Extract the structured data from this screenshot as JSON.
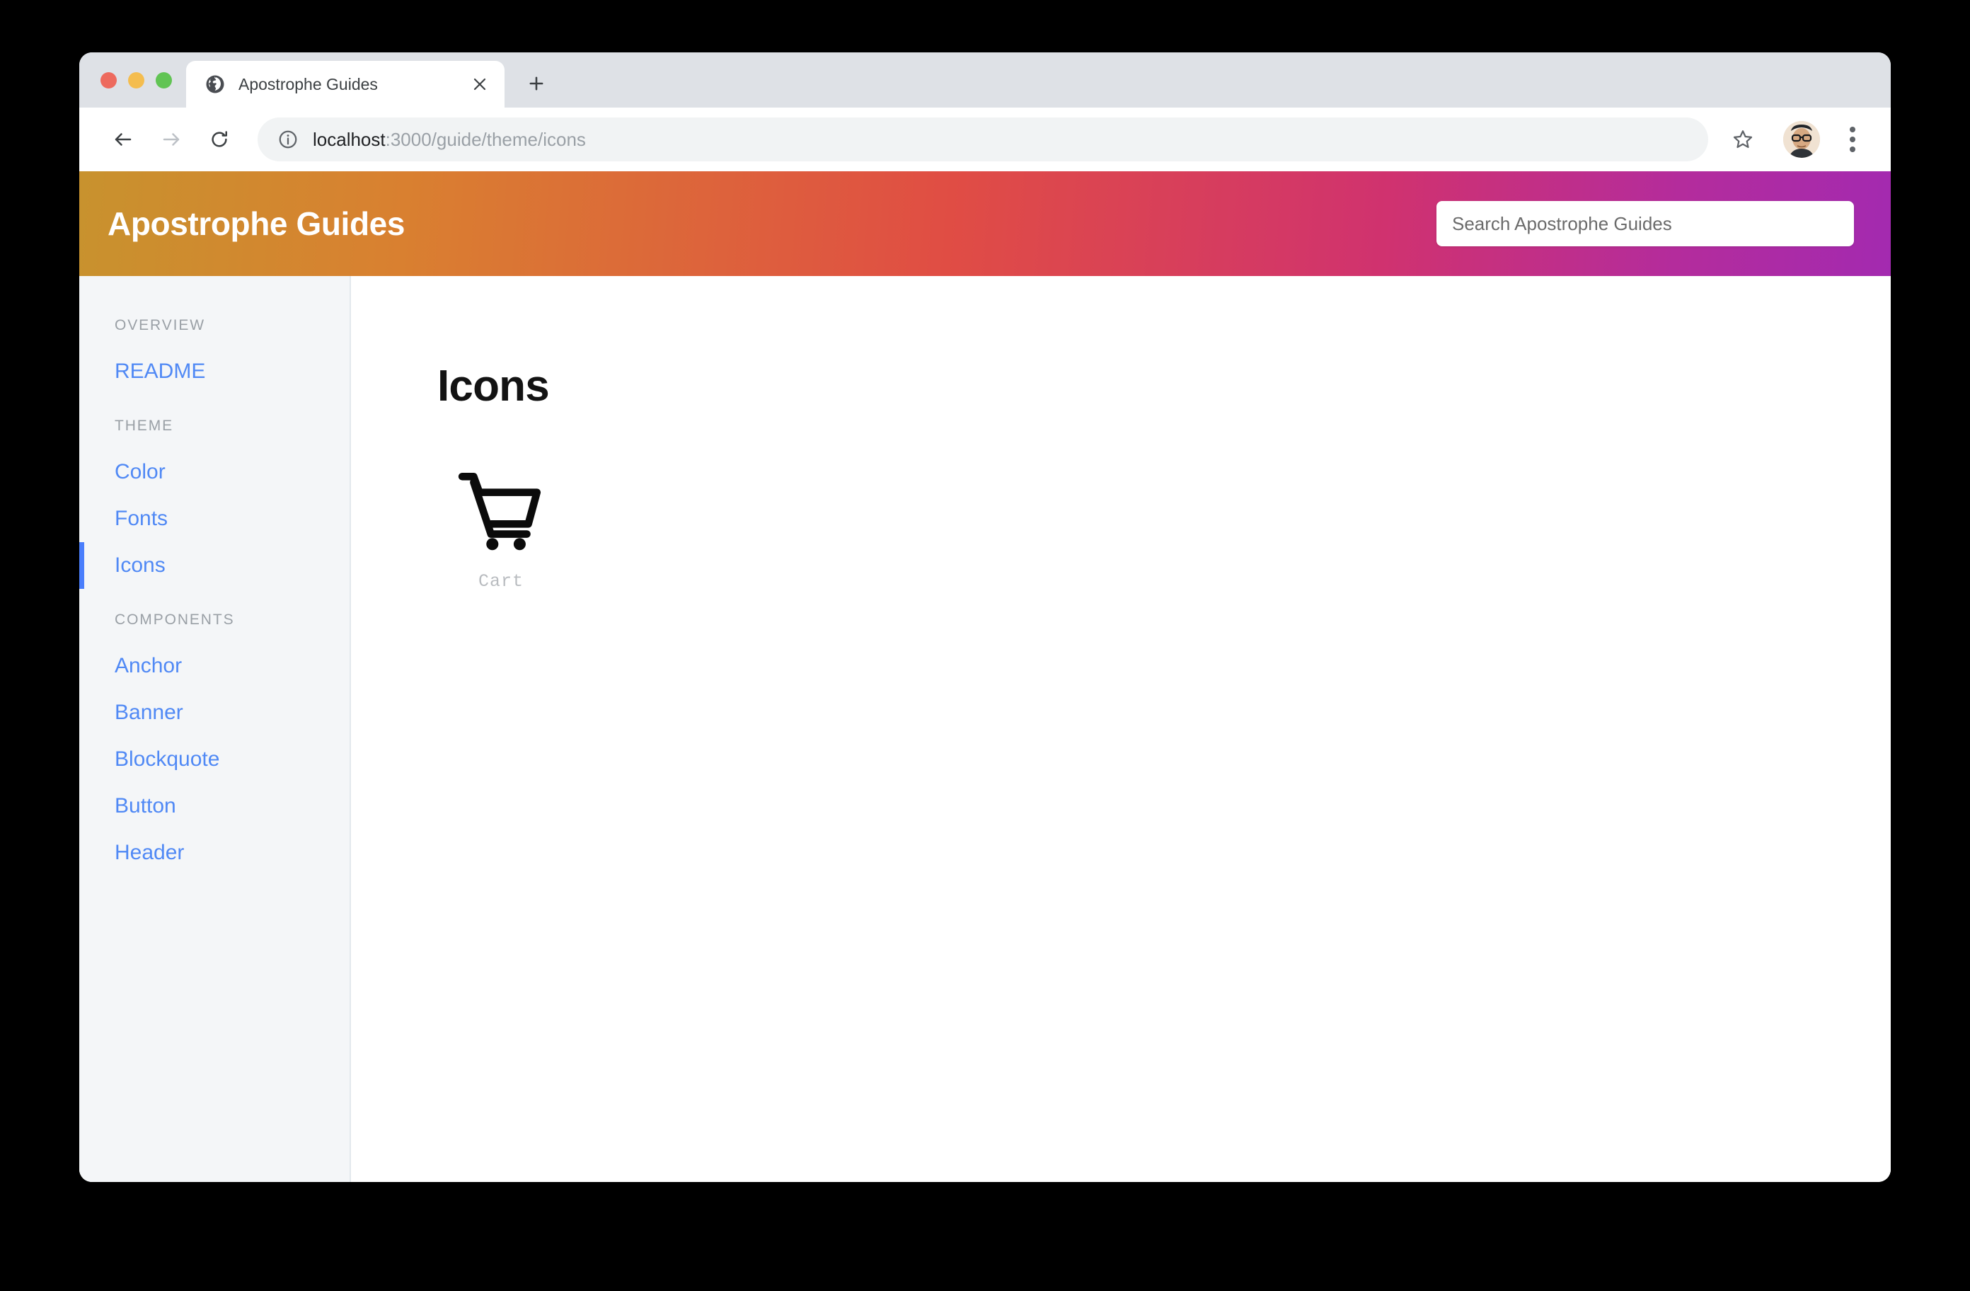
{
  "browser": {
    "tab": {
      "title": "Apostrophe Guides",
      "favicon": "globe-icon",
      "close": "×"
    },
    "new_tab_label": "+",
    "toolbar": {
      "back": "←",
      "forward": "→",
      "reload": "↻",
      "info_icon": "info-icon",
      "url_host": "localhost",
      "url_path": ":3000/guide/theme/icons",
      "star_icon": "bookmark-star-icon",
      "avatar": "user-avatar",
      "menu_icon": "three-dot-menu-icon"
    },
    "window_controls": [
      "close",
      "minimize",
      "maximize"
    ]
  },
  "site": {
    "title": "Apostrophe Guides",
    "search": {
      "placeholder": "Search Apostrophe Guides",
      "value": ""
    },
    "gradient": {
      "from": "#c8922e",
      "mid": "#e04d44",
      "to": "#a32ab0"
    }
  },
  "sidebar": {
    "sections": [
      {
        "heading": "OVERVIEW",
        "items": [
          {
            "label": "README",
            "active": false
          }
        ]
      },
      {
        "heading": "THEME",
        "items": [
          {
            "label": "Color",
            "active": false
          },
          {
            "label": "Fonts",
            "active": false
          },
          {
            "label": "Icons",
            "active": true
          }
        ]
      },
      {
        "heading": "COMPONENTS",
        "items": [
          {
            "label": "Anchor",
            "active": false
          },
          {
            "label": "Banner",
            "active": false
          },
          {
            "label": "Blockquote",
            "active": false
          },
          {
            "label": "Button",
            "active": false
          },
          {
            "label": "Header",
            "active": false
          }
        ]
      }
    ],
    "active_color": "#4a7efc",
    "link_color": "#5089f5"
  },
  "main": {
    "title": "Icons",
    "icons": [
      {
        "name": "cart-icon",
        "label": "Cart"
      }
    ]
  }
}
